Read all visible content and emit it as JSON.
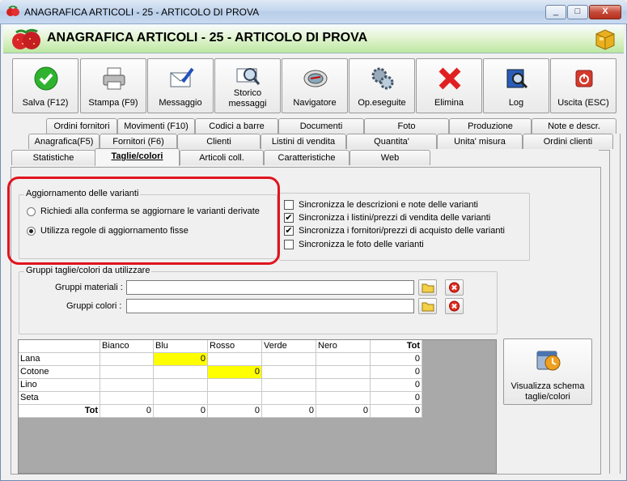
{
  "window": {
    "title": "ANAGRAFICA ARTICOLI - 25 - ARTICOLO DI PROVA",
    "min": "_",
    "max": "□",
    "close": "X"
  },
  "header": {
    "title": "ANAGRAFICA ARTICOLI - 25 - ARTICOLO DI PROVA"
  },
  "toolbar": {
    "save": "Salva (F12)",
    "print": "Stampa (F9)",
    "message": "Messaggio",
    "history_1": "Storico",
    "history_2": "messaggi",
    "navigator": "Navigatore",
    "ops_done": "Op.eseguite",
    "delete": "Elimina",
    "log": "Log",
    "exit": "Uscita (ESC)"
  },
  "tabs": {
    "row1": [
      "Ordini fornitori",
      "Movimenti (F10)",
      "Codici a barre",
      "Documenti",
      "Foto",
      "Produzione",
      "Note e descr."
    ],
    "row2": [
      "Anagrafica(F5)",
      "Fornitori (F6)",
      "Clienti",
      "Listini di vendita",
      "Quantita'",
      "Unita' misura",
      "Ordini clienti"
    ],
    "row3": [
      "Statistiche",
      "Taglie/colori",
      "Articoli coll.",
      "Caratteristiche",
      "Web"
    ]
  },
  "variants_update": {
    "title": "Aggiornamento delle varianti",
    "option_ask": "Richiedi alla conferma se aggiornare le varianti derivate",
    "option_fixed": "Utilizza regole di aggiornamento fisse",
    "selected": "option_fixed"
  },
  "sync": {
    "descriptions": {
      "label": "Sincronizza le descrizioni e note delle varianti",
      "checked": false
    },
    "sale_prices": {
      "label": "Sincronizza i listini/prezzi di vendita delle varianti",
      "checked": true
    },
    "purchase_prices": {
      "label": "Sincronizza i fornitori/prezzi di acquisto delle varianti",
      "checked": true
    },
    "photos": {
      "label": "Sincronizza le foto delle varianti",
      "checked": false
    },
    "check_mark": "✔"
  },
  "groups": {
    "title": "Gruppi taglie/colori da utilizzare",
    "materials_label": "Gruppi materiali :",
    "materials_value": "",
    "colors_label": "Gruppi colori :",
    "colors_value": ""
  },
  "grid": {
    "columns": [
      "",
      "Bianco",
      "Blu",
      "Rosso",
      "Verde",
      "Nero",
      "Tot"
    ],
    "rows": [
      {
        "label": "Lana",
        "values": [
          "",
          "0",
          "",
          "",
          "",
          "0"
        ]
      },
      {
        "label": "Cotone",
        "values": [
          "",
          "",
          "0",
          "",
          "",
          "0"
        ]
      },
      {
        "label": "Lino",
        "values": [
          "",
          "",
          "",
          "",
          "",
          "0"
        ]
      },
      {
        "label": "Seta",
        "values": [
          "",
          "",
          "",
          "",
          "",
          "0"
        ]
      },
      {
        "label": "Tot",
        "values": [
          "0",
          "0",
          "0",
          "0",
          "0",
          "0"
        ]
      }
    ],
    "highlight_color": "#ffff00"
  },
  "view_schema_button": {
    "line1": "Visualizza schema",
    "line2": "taglie/colori"
  }
}
